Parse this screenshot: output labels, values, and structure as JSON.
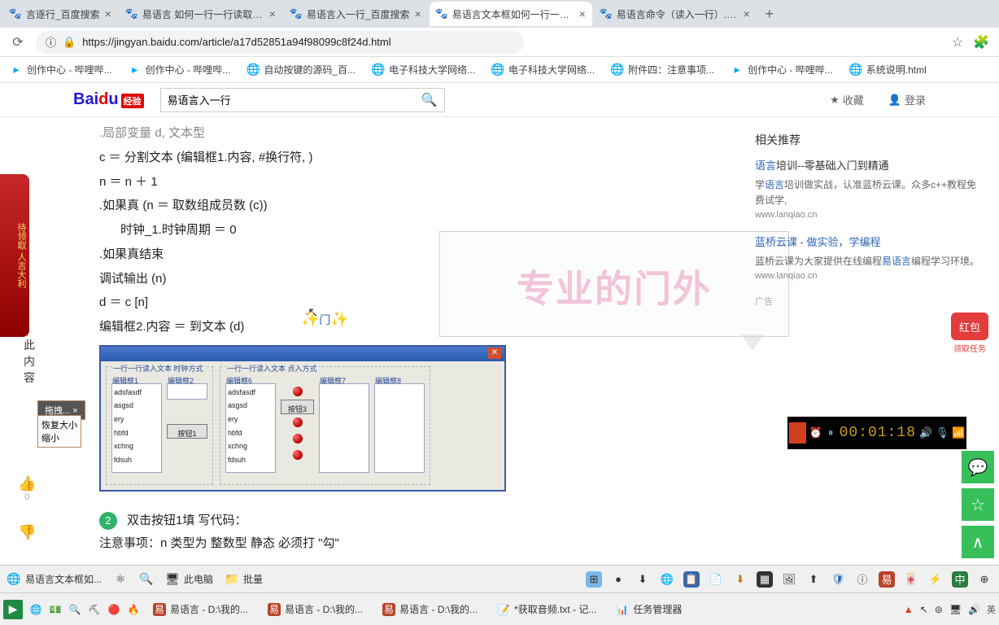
{
  "tabs": [
    {
      "icon": "paw",
      "label": "言逐行_百度搜索"
    },
    {
      "icon": "paw",
      "label": "易语言 如何一行一行读取编辑"
    },
    {
      "icon": "paw",
      "label": "易语言入一行_百度搜索"
    },
    {
      "icon": "paw",
      "label": "易语言文本框如何一行一行写",
      "active": true
    },
    {
      "icon": "paw",
      "label": "易语言命令（读入一行）......"
    }
  ],
  "url": "https://jingyan.baidu.com/article/a17d52851a94f98099c8f24d.html",
  "bookmarks": [
    {
      "icon": "tv",
      "label": "创作中心 - 哔哩哔..."
    },
    {
      "icon": "tv",
      "label": "创作中心 - 哔哩哔..."
    },
    {
      "icon": "globe",
      "label": "自动按键的源码_百..."
    },
    {
      "icon": "globe",
      "label": "电子科技大学网络..."
    },
    {
      "icon": "globe",
      "label": "电子科技大学网络..."
    },
    {
      "icon": "globe",
      "label": "附件四：注意事项..."
    },
    {
      "icon": "tv",
      "label": "创作中心 - 哔哩哔..."
    },
    {
      "icon": "globe",
      "label": "系统说明.html"
    }
  ],
  "logo_tag": "经验",
  "search_value": "易语言入一行",
  "hdr": {
    "fav": "收藏",
    "login": "登录"
  },
  "left_red": "待领取\n人吉大利",
  "toc": "此\n内\n容",
  "drag_tip": "拖拽...",
  "drag_box": "恢复大小\n缩小",
  "like_count": "0",
  "code": [
    ".局部变量 d, 文本型",
    "c ＝ 分割文本 (编辑框1.内容, #换行符, )",
    "n ＝ n ＋ 1",
    ".如果真 (n ＝ 取数组成员数 (c))",
    "    时钟_1.时钟周期 ＝ 0",
    ".如果真结束",
    "调试输出 (n)",
    "d ＝ c [n]",
    "编辑框2.内容 ＝ 到文本 (d)"
  ],
  "ide": {
    "group1_title": "一行一行读入文本  时钟方式",
    "group2_title": "一行一行读入文本  点入方式",
    "edit1": "编辑框1",
    "edit2": "编辑框2",
    "edit6": "编辑框6",
    "edit7": "编辑框7",
    "edit8": "编辑框8",
    "btn1": "按钮1",
    "btn3": "按钮3",
    "sample": "adsfasdf\nasgsd\nery\nhbfd\nxchng\nfdsuh"
  },
  "cursor_badge": "门",
  "step_num": "2",
  "step_line1": "双击按钮1填 写代码：",
  "step_line2": "注意事项：n 类型为 整数型  静态 必须打 \"勾\"",
  "rside": {
    "title": "相关推荐",
    "rec1_title_a": "语言",
    "rec1_title_b": "培训--零基础入门到精通",
    "rec1_body_a": "学",
    "rec1_body_b": "语言",
    "rec1_body_c": "培训做实战，认准蓝桥云课。众多c++教程免费试学,",
    "rec1_url": "www.lanqiao.cn",
    "rec2_title": "蓝桥云课 - 做实验，学编程",
    "rec2_body_a": "蓝桥云课为大家提供在线编程",
    "rec2_body_b": "易语言",
    "rec2_body_c": "编程学习环境。",
    "rec2_url": "www.lanqiao.cn",
    "ad": "广告"
  },
  "ghost": "专业的门外",
  "red_env": {
    "ico": "红包",
    "txt": "领取任务"
  },
  "rec_time": "00:01:18",
  "tb1": {
    "item1": "易语言文本框如...",
    "item2": "此电脑",
    "item3": "批量"
  },
  "tb2": {
    "item1": "易语言 - D:\\我的...",
    "item2": "易语言 - D:\\我的...",
    "item3": "易语言 - D:\\我的...",
    "item4": "*获取音频.txt - 记...",
    "item5": "任务管理器",
    "ime": "英"
  }
}
